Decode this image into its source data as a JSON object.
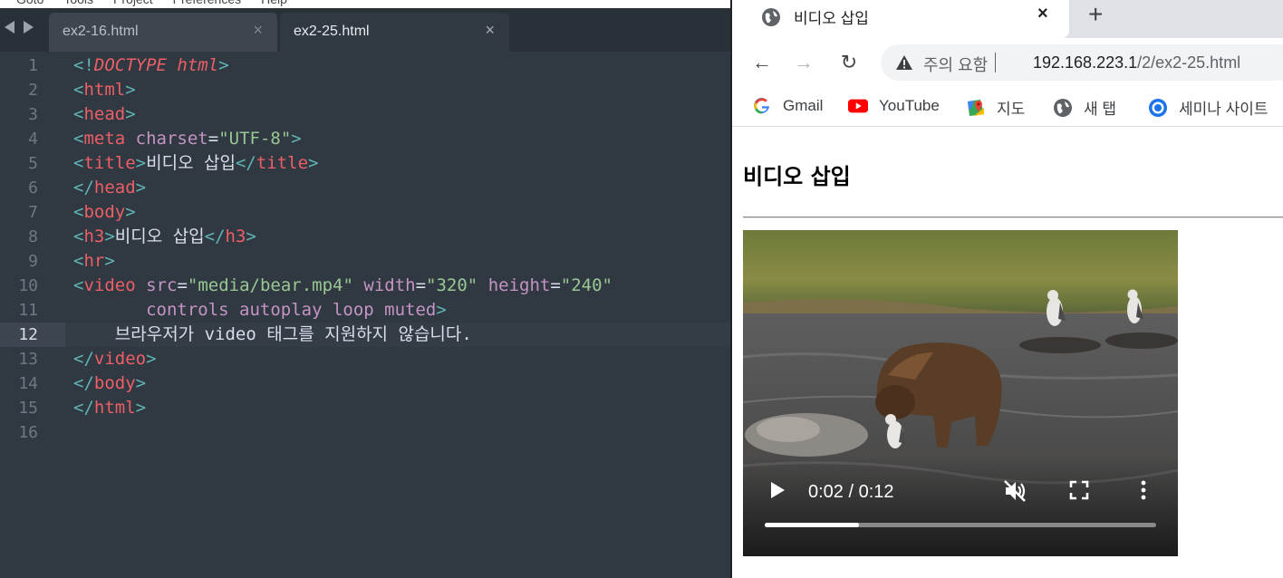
{
  "editor": {
    "menu": [
      "Goto",
      "Tools",
      "Project",
      "Preferences",
      "Help"
    ],
    "tabs": [
      {
        "label": "ex2-16.html",
        "close": "×",
        "active": false
      },
      {
        "label": "ex2-25.html",
        "close": "×",
        "active": true
      }
    ],
    "current_line": 12,
    "lines": [
      {
        "n": "1",
        "tokens": [
          [
            "<!",
            "t-b"
          ],
          [
            "DOCTYPE",
            "t-r t-i"
          ],
          [
            " ",
            "t-w"
          ],
          [
            "html",
            "t-r t-i"
          ],
          [
            ">",
            "t-b"
          ]
        ]
      },
      {
        "n": "2",
        "tokens": [
          [
            "<",
            "t-b"
          ],
          [
            "html",
            "t-r"
          ],
          [
            ">",
            "t-b"
          ]
        ]
      },
      {
        "n": "3",
        "tokens": [
          [
            "<",
            "t-b"
          ],
          [
            "head",
            "t-r"
          ],
          [
            ">",
            "t-b"
          ]
        ]
      },
      {
        "n": "4",
        "tokens": [
          [
            "<",
            "t-b"
          ],
          [
            "meta",
            "t-r"
          ],
          [
            " ",
            "t-w"
          ],
          [
            "charset",
            "t-p"
          ],
          [
            "=",
            "t-w"
          ],
          [
            "\"UTF-8\"",
            "t-g"
          ],
          [
            ">",
            "t-b"
          ]
        ]
      },
      {
        "n": "5",
        "tokens": [
          [
            "<",
            "t-b"
          ],
          [
            "title",
            "t-r"
          ],
          [
            ">",
            "t-b"
          ],
          [
            "비디오 삽입",
            "t-w"
          ],
          [
            "</",
            "t-b"
          ],
          [
            "title",
            "t-r"
          ],
          [
            ">",
            "t-b"
          ]
        ]
      },
      {
        "n": "6",
        "tokens": [
          [
            "</",
            "t-b"
          ],
          [
            "head",
            "t-r"
          ],
          [
            ">",
            "t-b"
          ]
        ]
      },
      {
        "n": "7",
        "tokens": [
          [
            "<",
            "t-b"
          ],
          [
            "body",
            "t-r"
          ],
          [
            ">",
            "t-b"
          ]
        ]
      },
      {
        "n": "8",
        "tokens": [
          [
            "<",
            "t-b"
          ],
          [
            "h3",
            "t-r"
          ],
          [
            ">",
            "t-b"
          ],
          [
            "비디오 삽입",
            "t-w"
          ],
          [
            "</",
            "t-b"
          ],
          [
            "h3",
            "t-r"
          ],
          [
            ">",
            "t-b"
          ]
        ]
      },
      {
        "n": "9",
        "tokens": [
          [
            "<",
            "t-b"
          ],
          [
            "hr",
            "t-r"
          ],
          [
            ">",
            "t-b"
          ]
        ]
      },
      {
        "n": "10",
        "tokens": [
          [
            "<",
            "t-b"
          ],
          [
            "video",
            "t-r"
          ],
          [
            " ",
            "t-w"
          ],
          [
            "src",
            "t-p"
          ],
          [
            "=",
            "t-w"
          ],
          [
            "\"media/bear.mp4\"",
            "t-g"
          ],
          [
            " ",
            "t-w"
          ],
          [
            "width",
            "t-p"
          ],
          [
            "=",
            "t-w"
          ],
          [
            "\"320\"",
            "t-g"
          ],
          [
            " ",
            "t-w"
          ],
          [
            "height",
            "t-p"
          ],
          [
            "=",
            "t-w"
          ],
          [
            "\"240\"",
            "t-g"
          ]
        ]
      },
      {
        "n": "11",
        "tokens": [
          [
            "       ",
            "t-w"
          ],
          [
            "controls autoplay loop muted",
            "t-p"
          ],
          [
            ">",
            "t-b"
          ]
        ]
      },
      {
        "n": "12",
        "tokens": [
          [
            "    브라우저가 video 태그를 지원하지 않습니다.",
            "t-w"
          ]
        ]
      },
      {
        "n": "13",
        "tokens": [
          [
            "</",
            "t-b"
          ],
          [
            "video",
            "t-r"
          ],
          [
            ">",
            "t-b"
          ]
        ]
      },
      {
        "n": "14",
        "tokens": [
          [
            "</",
            "t-b"
          ],
          [
            "body",
            "t-r"
          ],
          [
            ">",
            "t-b"
          ]
        ]
      },
      {
        "n": "15",
        "tokens": [
          [
            "</",
            "t-b"
          ],
          [
            "html",
            "t-r"
          ],
          [
            ">",
            "t-b"
          ]
        ]
      },
      {
        "n": "16",
        "tokens": []
      }
    ]
  },
  "browser": {
    "tab_title": "비디오 삽입",
    "tab_close": "×",
    "new_tab": "+",
    "nav": {
      "back": "←",
      "forward": "→",
      "reload": "↻"
    },
    "omnibox": {
      "warning": "주의 요함",
      "url_host": "192.168.223.1",
      "url_path": "/2/ex2-25.html"
    },
    "bookmarks": [
      {
        "label": "Gmail",
        "icon": "google-icon"
      },
      {
        "label": "YouTube",
        "icon": "youtube-icon"
      },
      {
        "label": "지도",
        "icon": "maps-icon"
      },
      {
        "label": "새 탭",
        "icon": "globe-icon"
      },
      {
        "label": "세미나 사이트",
        "icon": "chrome-icon"
      }
    ],
    "page": {
      "heading": "비디오 삽입",
      "video": {
        "time": "0:02 / 0:12",
        "progress": 0.24,
        "muted": true
      }
    }
  }
}
